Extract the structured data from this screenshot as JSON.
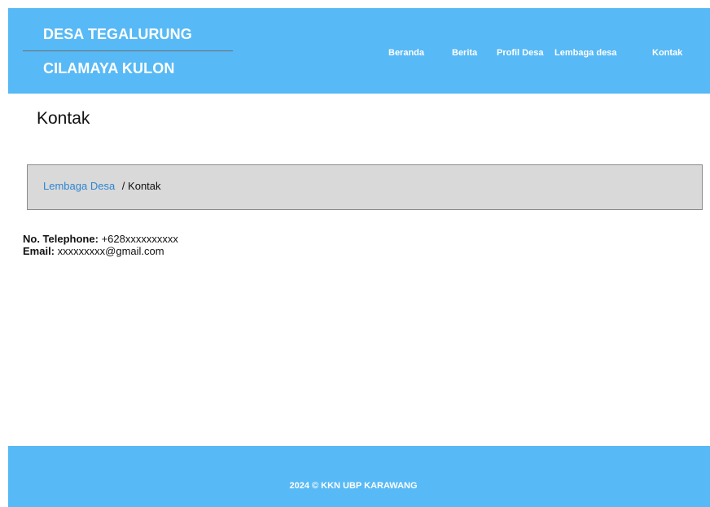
{
  "header": {
    "brand_line1": "DESA TEGALURUNG",
    "brand_line2": "CILAMAYA KULON",
    "nav": {
      "beranda": "Beranda",
      "berita": "Berita",
      "profil_desa": "Profil Desa",
      "lembaga_desa": "Lembaga desa",
      "kontak": "Kontak"
    }
  },
  "main": {
    "title": "Kontak",
    "breadcrumb": {
      "parent": "Lembaga Desa",
      "separator": "/",
      "current": "Kontak"
    },
    "contact": {
      "phone_label": "No. Telephone:",
      "phone_value": "+628xxxxxxxxxx",
      "email_label": "Email:",
      "email_value": "xxxxxxxxx@gmail.com"
    }
  },
  "footer": {
    "text": "2024 © KKN UBP KARAWANG"
  },
  "colors": {
    "header_bg": "#57b9f5",
    "footer_bg": "#57b9f5",
    "breadcrumb_bg": "#d9d9d9",
    "link": "#2e86d1"
  }
}
